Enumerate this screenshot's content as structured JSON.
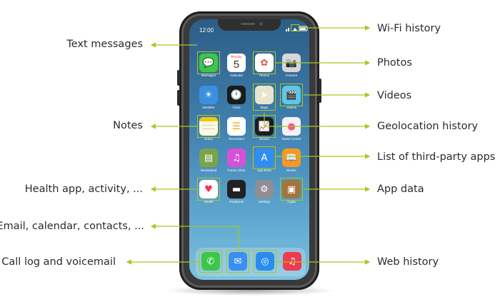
{
  "colors": {
    "accent_line": "#a8c820",
    "text": "#2b2b2b"
  },
  "phone": {
    "time": "12:00",
    "apps": [
      {
        "key": "messages",
        "label": "Messages",
        "icon": "message-bubble-icon",
        "bg": "#3cc74a"
      },
      {
        "key": "calendar",
        "label": "Calendar",
        "icon": "calendar-icon",
        "bg": "#ffffff",
        "day": "Monday",
        "date": "5"
      },
      {
        "key": "photos",
        "label": "Photos",
        "icon": "photos-flower-icon",
        "bg": "#ffffff"
      },
      {
        "key": "camera",
        "label": "Camera",
        "icon": "camera-icon",
        "bg": "#d7d7d7"
      },
      {
        "key": "weather",
        "label": "Weather",
        "icon": "weather-sun-cloud-icon",
        "bg": "#3b8fe0"
      },
      {
        "key": "clock",
        "label": "Clock",
        "icon": "clock-icon",
        "bg": "#1b1b1b"
      },
      {
        "key": "maps",
        "label": "Maps",
        "icon": "maps-icon",
        "bg": "#e9e6cf"
      },
      {
        "key": "videos",
        "label": "Videos",
        "icon": "clapperboard-icon",
        "bg": "#5cc7e8"
      },
      {
        "key": "notes",
        "label": "Notes",
        "icon": "notes-icon",
        "bg": "#fffbe0"
      },
      {
        "key": "reminders",
        "label": "Reminders",
        "icon": "reminders-list-icon",
        "bg": "#ffffff"
      },
      {
        "key": "stocks",
        "label": "Stocks",
        "icon": "stocks-chart-icon",
        "bg": "#1d1d1d"
      },
      {
        "key": "gamecenter",
        "label": "Game Center",
        "icon": "game-center-bubbles-icon",
        "bg": "#f2f2f2"
      },
      {
        "key": "newsstand",
        "label": "Newsstand",
        "icon": "newsstand-icon",
        "bg": "#7aa34a"
      },
      {
        "key": "itunes",
        "label": "iTunes Store",
        "icon": "itunes-note-icon",
        "bg": "#d552d8"
      },
      {
        "key": "appstore",
        "label": "App Store",
        "icon": "app-store-icon",
        "bg": "#2f8ef0"
      },
      {
        "key": "ibooks",
        "label": "iBooks",
        "icon": "ibooks-icon",
        "bg": "#f49a22"
      },
      {
        "key": "health",
        "label": "Health",
        "icon": "heart-icon",
        "bg": "#ffffff"
      },
      {
        "key": "passbook",
        "label": "Passbook",
        "icon": "passbook-icon",
        "bg": "#222222"
      },
      {
        "key": "settings",
        "label": "Settings",
        "icon": "gear-icon",
        "bg": "#8e8e93"
      },
      {
        "key": "cydia",
        "label": "Cydia",
        "icon": "cydia-box-icon",
        "bg": "#a4743e"
      }
    ],
    "dock": [
      {
        "key": "phone",
        "icon": "phone-handset-icon",
        "bg": "#3cc74a"
      },
      {
        "key": "mail",
        "icon": "mail-envelope-icon",
        "bg": "#3a8ff0"
      },
      {
        "key": "safari",
        "icon": "safari-compass-icon",
        "bg": "#2b8cf0"
      },
      {
        "key": "music",
        "icon": "music-note-icon",
        "bg": "#f03a4f"
      }
    ]
  },
  "callouts_left": {
    "text_messages": "Text messages",
    "notes": "Notes",
    "health": "Health app, activity, ...",
    "email": "Email, calendar, contacts, ...",
    "calllog": "Call log and voicemail"
  },
  "callouts_right": {
    "wifi": "Wi-Fi history",
    "photos": "Photos",
    "videos": "Videos",
    "geolocation": "Geolocation history",
    "thirdparty": "List of third-party apps",
    "appdata": "App data",
    "webhistory": "Web history"
  }
}
